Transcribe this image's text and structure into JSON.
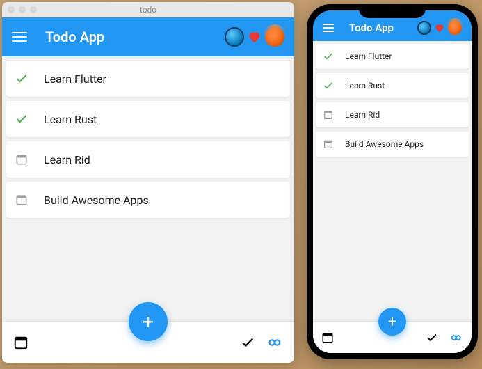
{
  "desktop": {
    "window_title": "todo",
    "header": {
      "title": "Todo App",
      "icons": [
        "flutter-icon",
        "heart-icon",
        "rust-icon"
      ]
    },
    "todos": [
      {
        "label": "Learn Flutter",
        "done": true
      },
      {
        "label": "Learn Rust",
        "done": true
      },
      {
        "label": "Learn Rid",
        "done": false
      },
      {
        "label": "Build Awesome Apps",
        "done": false
      }
    ],
    "fab_label": "+",
    "bottom": {
      "left_icons": [
        "calendar-icon"
      ],
      "right_icons": [
        "check-icon",
        "infinity-icon"
      ]
    }
  },
  "mobile": {
    "header": {
      "title": "Todo App",
      "icons": [
        "flutter-icon",
        "heart-icon",
        "rust-icon"
      ]
    },
    "todos": [
      {
        "label": "Learn Flutter",
        "done": true
      },
      {
        "label": "Learn Rust",
        "done": true
      },
      {
        "label": "Learn Rid",
        "done": false
      },
      {
        "label": "Build Awesome Apps",
        "done": false
      }
    ],
    "fab_label": "+",
    "bottom": {
      "left_icons": [
        "calendar-icon"
      ],
      "right_icons": [
        "check-icon",
        "infinity-icon"
      ]
    }
  },
  "colors": {
    "primary": "#2196f3",
    "done": "#4caf50",
    "pending": "#9e9e9e",
    "heart": "#e53935",
    "infinity": "#2196f3"
  }
}
